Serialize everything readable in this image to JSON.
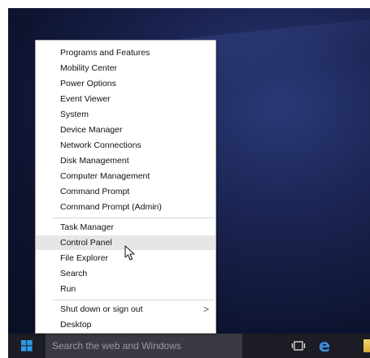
{
  "menu": {
    "group1": [
      "Programs and Features",
      "Mobility Center",
      "Power Options",
      "Event Viewer",
      "System",
      "Device Manager",
      "Network Connections",
      "Disk Management",
      "Computer Management",
      "Command Prompt",
      "Command Prompt (Admin)"
    ],
    "group2": [
      "Task Manager",
      "Control Panel",
      "File Explorer",
      "Search",
      "Run"
    ],
    "group3": [
      "Shut down or sign out",
      "Desktop"
    ],
    "highlighted": "Control Panel",
    "submenu_arrow": ">"
  },
  "taskbar": {
    "search_placeholder": "Search the web and Windows",
    "edge_glyph": "e",
    "icons": [
      "windows-logo-icon",
      "task-view-icon",
      "edge-icon",
      "file-explorer-icon"
    ]
  },
  "colors": {
    "taskbar": "#1c1c24",
    "search_box": "#3a3a42",
    "menu_highlight": "#e6e6e6",
    "edge_blue": "#3b8fe0"
  }
}
